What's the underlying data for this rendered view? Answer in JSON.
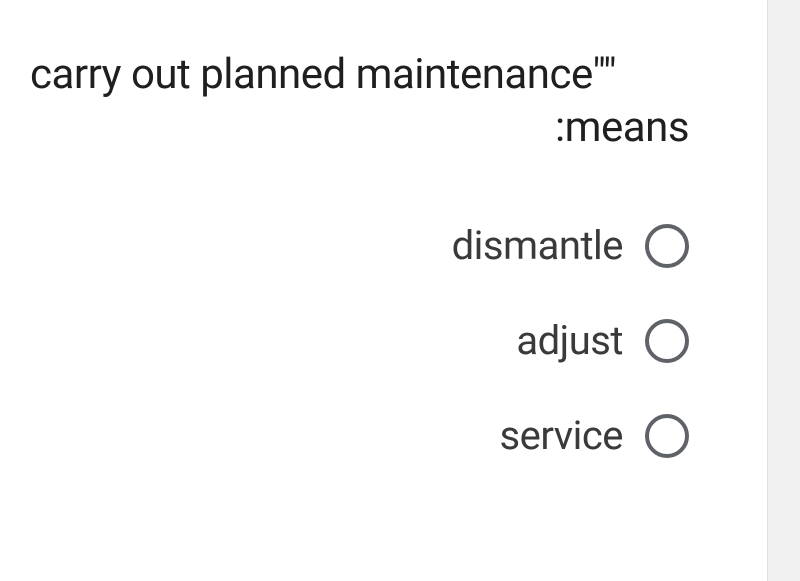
{
  "question": {
    "line1": "carry out planned maintenance\"\"",
    "line2": ":means"
  },
  "options": [
    {
      "label": "dismantle"
    },
    {
      "label": "adjust"
    },
    {
      "label": "service"
    }
  ]
}
